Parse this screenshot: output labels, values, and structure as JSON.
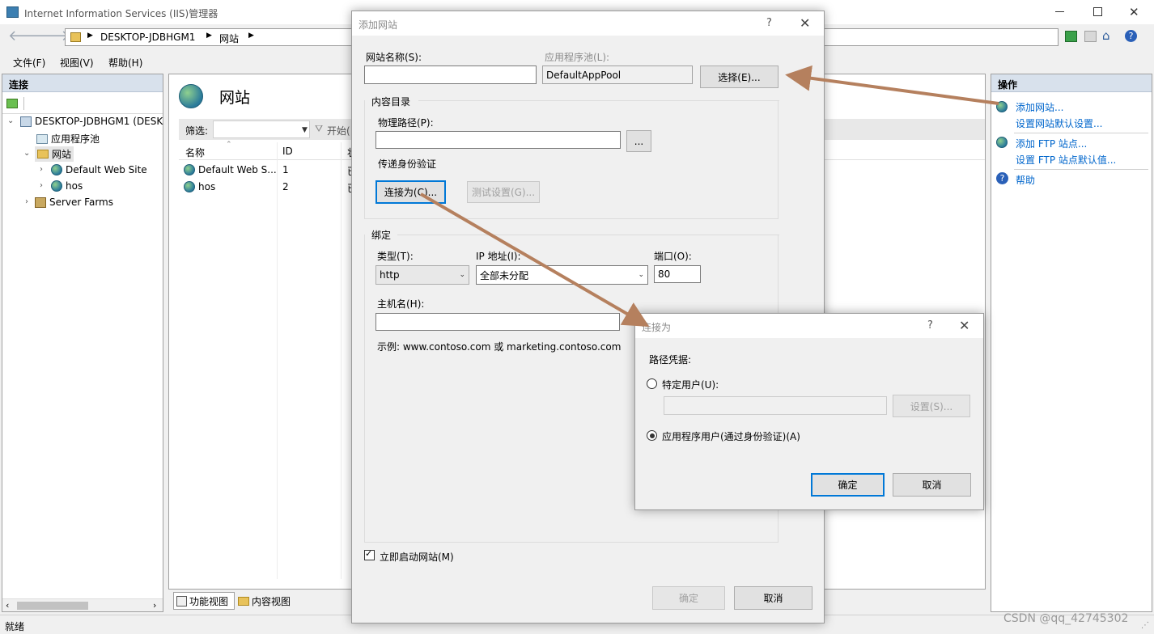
{
  "main_window": {
    "title": "Internet Information Services (IIS)管理器",
    "address": {
      "segments": [
        "DESKTOP-JDBHGM1",
        "网站"
      ]
    },
    "menu": [
      "文件(F)",
      "视图(V)",
      "帮助(H)"
    ],
    "status_text": "就绪"
  },
  "connections": {
    "header": "连接",
    "tree": {
      "root": "DESKTOP-JDBHGM1 (DESK",
      "app_pools": "应用程序池",
      "sites": "网站",
      "site1": "Default Web Site",
      "site2": "hos",
      "farms": "Server Farms"
    }
  },
  "center": {
    "title": "网站",
    "filter_label": "筛选:",
    "start_label": "开始(",
    "columns": [
      "名称",
      "ID",
      "状"
    ],
    "rows": [
      {
        "name": "Default Web S...",
        "id": "1",
        "state": "已"
      },
      {
        "name": "hos",
        "id": "2",
        "state": "已"
      }
    ],
    "bottom_tabs": [
      "功能视图",
      "内容视图"
    ]
  },
  "actions": {
    "header": "操作",
    "items": [
      "添加网站...",
      "设置网站默认设置...",
      "添加 FTP 站点...",
      "设置 FTP 站点默认值...",
      "帮助"
    ]
  },
  "add_site_dialog": {
    "title": "添加网站",
    "help_glyph": "?",
    "close_glyph": "✕",
    "site_name_label": "网站名称(S):",
    "site_name_value": "",
    "app_pool_label": "应用程序池(L):",
    "app_pool_value": "DefaultAppPool",
    "select_button": "选择(E)...",
    "content_dir_label": "内容目录",
    "physical_path_label": "物理路径(P):",
    "physical_path_value": "",
    "browse_button": "...",
    "pass_auth_label": "传递身份验证",
    "connect_as_button": "连接为(C)...",
    "test_settings_button": "测试设置(G)...",
    "binding_label": "绑定",
    "type_label": "类型(T):",
    "type_value": "http",
    "ip_label": "IP 地址(I):",
    "ip_value": "全部未分配",
    "port_label": "端口(O):",
    "port_value": "80",
    "hostname_label": "主机名(H):",
    "hostname_value": "",
    "example_text": "示例: www.contoso.com 或 marketing.contoso.com",
    "start_now_label": "立即启动网站(M)",
    "ok_button": "确定",
    "cancel_button": "取消"
  },
  "connect_as_dialog": {
    "title": "连接为",
    "help_glyph": "?",
    "close_glyph": "✕",
    "path_credentials_label": "路径凭据:",
    "specific_user_label": "特定用户(U):",
    "set_button": "设置(S)...",
    "app_user_label": "应用程序用户(通过身份验证)(A)",
    "ok_button": "确定",
    "cancel_button": "取消"
  },
  "watermark": "CSDN @qq_42745302",
  "colors": {
    "accent": "#0078d7",
    "arrow": "#b5805e",
    "link": "#0066cc"
  }
}
